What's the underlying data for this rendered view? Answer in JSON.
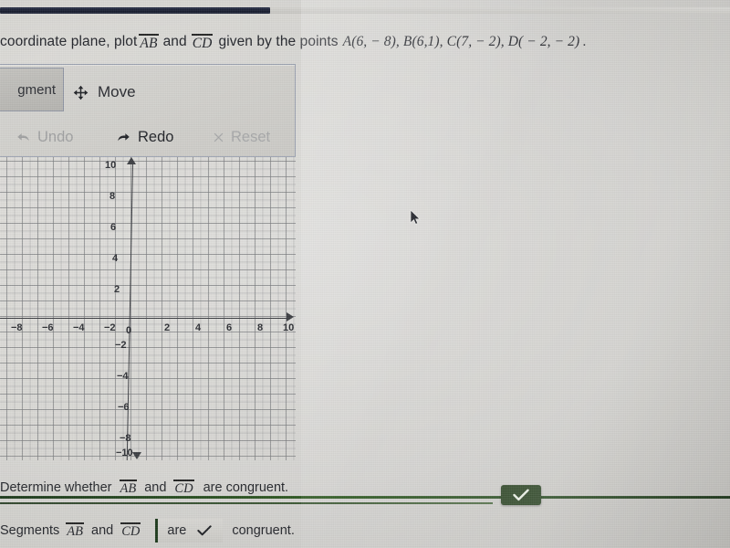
{
  "prompt": {
    "lead": "coordinate plane, plot",
    "seg1": "AB",
    "conj": "and",
    "seg2": "CD",
    "mid": "given by the points",
    "point_a": "A(6, − 8),",
    "point_b": "B(6,1),",
    "point_c": "C(7, − 2),",
    "point_d": "D( − 2, − 2)",
    "period": "."
  },
  "toolbar": {
    "tab_label": "gment",
    "move_label": "Move",
    "undo_label": "Undo",
    "redo_label": "Redo",
    "reset_label": "Reset",
    "move_icon": "move-arrows-icon",
    "undo_icon": "undo-arrow-icon",
    "redo_icon": "redo-arrow-icon",
    "reset_icon": "close-x-icon"
  },
  "graph": {
    "x_ticks": [
      "−8",
      "−6",
      "−4",
      "−2",
      "0",
      "2",
      "4",
      "6",
      "8",
      "10"
    ],
    "y_ticks": [
      "10",
      "8",
      "6",
      "4",
      "2",
      "−2",
      "−4",
      "−6",
      "−8",
      "−10"
    ],
    "origin_label": "0"
  },
  "chart_data": {
    "type": "scatter",
    "title": "",
    "xlabel": "",
    "ylabel": "",
    "xlim": [
      -9,
      10
    ],
    "ylim": [
      -10,
      10
    ],
    "grid": true,
    "minor_grid_step": 0.5,
    "major_grid_step": 2,
    "x_tick_values": [
      -8,
      -6,
      -4,
      -2,
      0,
      2,
      4,
      6,
      8,
      10
    ],
    "y_tick_values": [
      10,
      8,
      6,
      4,
      2,
      -2,
      -4,
      -6,
      -8,
      -10
    ],
    "points": [],
    "series": [],
    "note": "Empty coordinate plane; no segments plotted yet."
  },
  "bottom": {
    "determine_lead": "Determine whether",
    "determine_seg1": "AB",
    "determine_and": "and",
    "determine_seg2": "CD",
    "determine_tail": "are congruent.",
    "badge_icon": "check-icon",
    "answer_lead": "Segments",
    "answer_seg1": "AB",
    "answer_and": "and",
    "answer_seg2": "CD",
    "dropdown_value": "are",
    "dropdown_icon": "check-icon",
    "answer_tail": "congruent."
  },
  "cursor": {
    "icon": "mouse-pointer-icon"
  },
  "colors": {
    "navbar": "#1b2132",
    "green_rule": "#24461d",
    "badge_green": "#243d1c",
    "text": "#24262b",
    "disabled_text": "#a0a1a2"
  }
}
